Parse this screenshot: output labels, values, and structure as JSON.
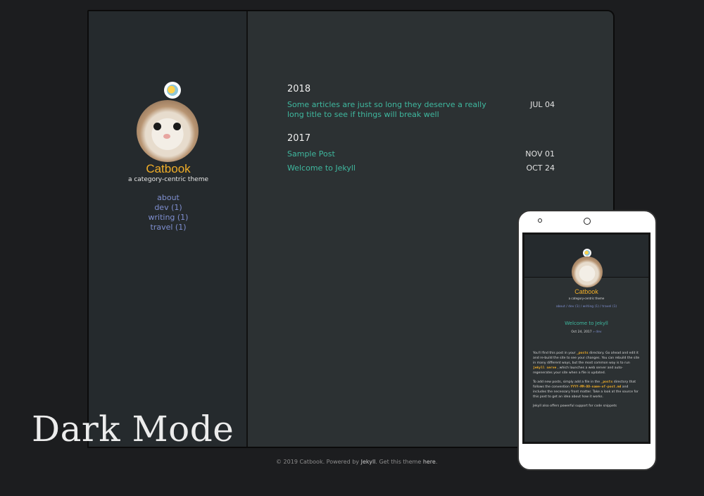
{
  "site": {
    "title": "Catbook",
    "tagline": "a category-centric theme",
    "nav": [
      "about",
      "dev (1)",
      "writing (1)",
      "travel (1)"
    ]
  },
  "archive": [
    {
      "year": "2018",
      "posts": [
        {
          "title": "Some articles are just so long they deserve a really long title to see if things will break well",
          "date": "JUL 04"
        }
      ]
    },
    {
      "year": "2017",
      "posts": [
        {
          "title": "Sample Post",
          "date": "NOV 01"
        },
        {
          "title": "Welcome to Jekyll",
          "date": "OCT 24"
        }
      ]
    }
  ],
  "footer": {
    "prefix": "© 2019 Catbook. Powered by",
    "jekyll": "Jekyll",
    "middle": ". Get this theme",
    "here": "here",
    "end": "."
  },
  "overlay_label": "Dark Mode",
  "phone": {
    "title": "Catbook",
    "tagline": "a category-centric theme",
    "nav": "about / dev (1) / writing (1) / travel (1)",
    "post_title": "Welcome to Jekyll",
    "post_date": "Oct 24, 2017",
    "post_category": "» dev",
    "p1_a": "You'll find this post in your",
    "p1_code1": "_posts",
    "p1_b": "directory. Go ahead and edit it and re-build the site to see your changes. You can rebuild the site in many different ways, but the most common way is to run",
    "p1_code2": "jekyll serve",
    "p1_c": ", which launches a web server and auto-regenerates your site when a file is updated.",
    "p2_a": "To add new posts, simply add a file in the",
    "p2_code1": "_posts",
    "p2_b": "directory that follows the convention",
    "p2_code2": "YYYY-MM-DD-name-of-post.md",
    "p2_c": "and includes the necessary front matter. Take a look at the source for this post to get an idea about how it works.",
    "p3": "Jekyll also offers powerful support for code snippets"
  },
  "colors": {
    "accent": "#f0ad27",
    "link": "#3fb89f",
    "nav": "#7f8fd0",
    "background": "#1c1d1f",
    "panel": "#2c3133"
  }
}
